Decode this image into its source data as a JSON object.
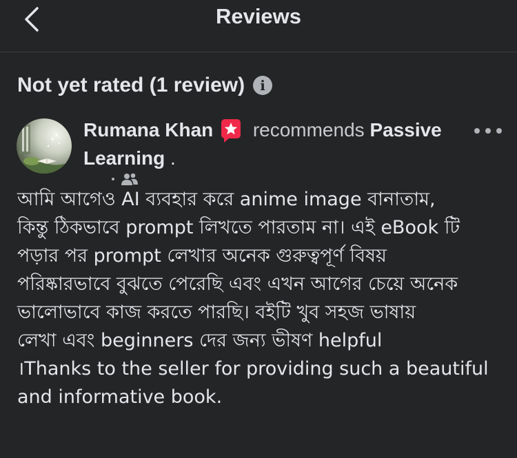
{
  "header": {
    "title": "Reviews",
    "back_icon": "chevron-left-icon"
  },
  "rating": {
    "title": "Not yet rated (1 review)",
    "info_icon": "info-icon"
  },
  "review": {
    "author": "Rumana Khan",
    "badge_icon": "recommendation-star-icon",
    "badge_color": "#f02849",
    "verb": "recommends",
    "page_name_line1": "Passive",
    "page_name_line2": "Learning",
    "suffix": " .",
    "audience_icon": "friends-icon",
    "body_lines": [
      "আমি আগেও AI ব্যবহার করে anime image বানাতাম,",
      "কিন্তু ঠিকভাবে prompt লিখতে পারতাম না। এই eBook টি",
      "পড়ার পর prompt লেখার অনেক গুরুত্বপূর্ণ বিষয়",
      "পরিষ্কারভাবে বুঝতে পেরেছি এবং এখন আগের চেয়ে অনেক",
      "ভালোভাবে কাজ করতে পারছি। বইটি খুব সহজ ভাষায়",
      "লেখা এবং beginners দের জন্য ভীষণ helpful",
      "।Thanks to the seller for providing such a beautiful",
      "and informative book."
    ]
  },
  "colors": {
    "background": "#242526",
    "text": "#e4e6eb",
    "secondary": "#b0b3b8"
  }
}
